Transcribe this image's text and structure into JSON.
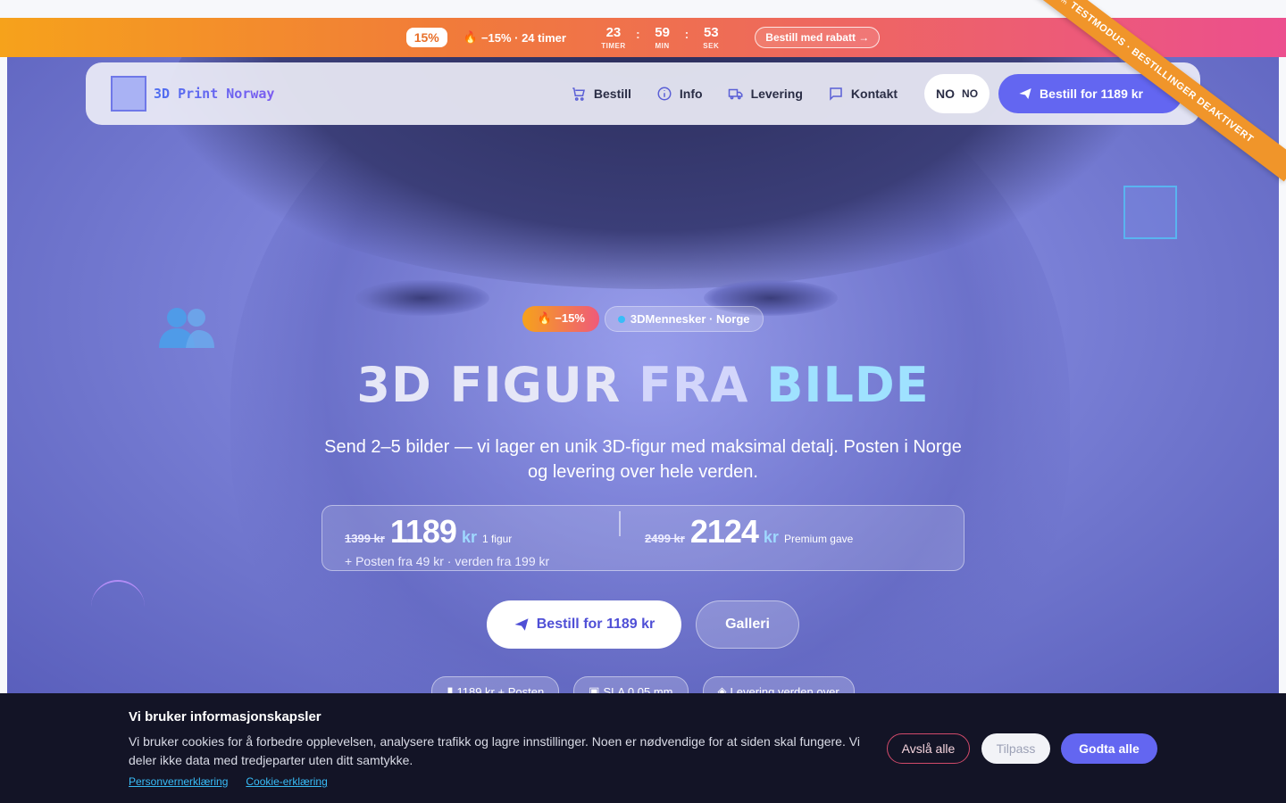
{
  "promo": {
    "badge": "15%",
    "deal": "−15% · 24 timer",
    "timer": [
      {
        "value": "23",
        "label": "TIMER"
      },
      {
        "value": "59",
        "label": "MIN"
      },
      {
        "value": "53",
        "label": "SEK"
      }
    ],
    "cta": "Bestill med rabatt →"
  },
  "ribbon": "TESTMODUS · BESTILLINGER DEAKTIVERT",
  "nav": {
    "logo": "3D Print Norway",
    "links": [
      {
        "label": "Bestill",
        "icon": "cart-icon"
      },
      {
        "label": "Info",
        "icon": "info-icon"
      },
      {
        "label": "Levering",
        "icon": "truck-icon"
      },
      {
        "label": "Kontakt",
        "icon": "chat-icon"
      }
    ],
    "lang_main": "NO",
    "lang_code": "NO",
    "cta": "Bestill for 1189 kr"
  },
  "hero": {
    "badge_hot": "−15%",
    "badge_brand": "3DMennesker · Norge",
    "title_a": "3D FIGUR ",
    "title_b": "FRA ",
    "title_c": "BILDE",
    "subtitle": "Send 2–5 bilder — vi lager en unik 3D-figur med maksimal detalj. Posten i Norge og levering over hele verden.",
    "price1": {
      "old": "1399 kr",
      "new": "1189",
      "unit": "kr",
      "note": "1 figur"
    },
    "price2": {
      "old": "2499 kr",
      "new": "2124",
      "unit": "kr",
      "note": "Premium gave"
    },
    "shipping": "+ Posten fra 49 kr · verden fra 199 kr",
    "order_btn": "Bestill for 1189 kr",
    "gallery_btn": "Galleri",
    "chips": [
      "1189 kr + Posten",
      "SLA 0.05 mm",
      "Levering verden over"
    ]
  },
  "cookie": {
    "title": "Vi bruker informasjonskapsler",
    "text": "Vi bruker cookies for å forbedre opplevelsen, analysere trafikk og lagre innstillinger. Noen er nødvendige for at siden skal fungere. Vi deler ikke data med tredjeparter uten ditt samtykke.",
    "link_privacy": "Personvernerklæring",
    "link_cookies": "Cookie-erklæring",
    "reject": "Avslå alle",
    "customize": "Tilpass",
    "accept": "Godta alle"
  },
  "colors": {
    "accent": "#6366f1",
    "promo_start": "#f6a21b",
    "promo_end": "#ec4f8e",
    "cookie_bg": "#131426"
  }
}
